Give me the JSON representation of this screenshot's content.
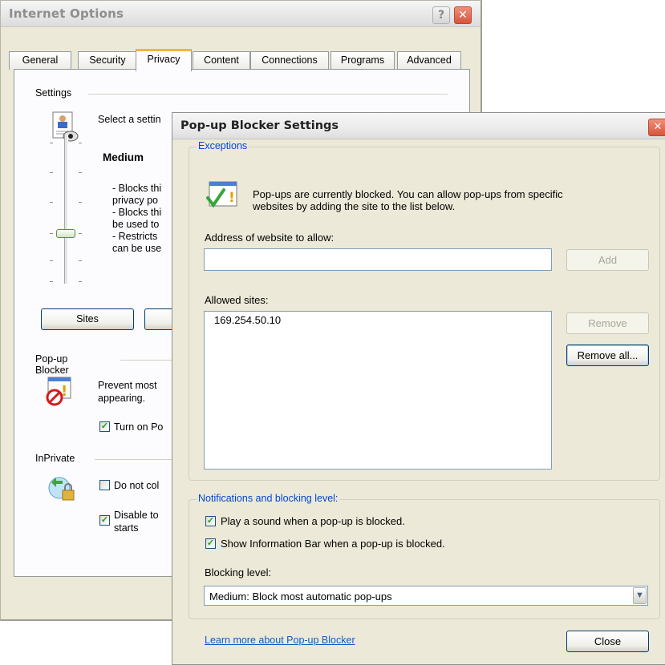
{
  "internet_options": {
    "title": "Internet Options",
    "help_glyph": "?",
    "close_glyph": "✕",
    "tabs": [
      {
        "label": "General"
      },
      {
        "label": "Security"
      },
      {
        "label": "Privacy"
      },
      {
        "label": "Content"
      },
      {
        "label": "Connections"
      },
      {
        "label": "Programs"
      },
      {
        "label": "Advanced"
      }
    ],
    "active_tab": "Privacy",
    "settings_group": "Settings",
    "select_setting_text": "Select a settin",
    "privacy_level": "Medium",
    "privacy_desc": [
      "- Blocks thi",
      "privacy po",
      "- Blocks thi",
      "be used to",
      "- Restricts",
      "can be use"
    ],
    "sites_button": "Sites",
    "popup_group": "Pop-up Blocker",
    "popup_desc_1": "Prevent most",
    "popup_desc_2": "appearing.",
    "turn_on_label": "Turn on Po",
    "turn_on_checked": true,
    "inprivate_group": "InPrivate",
    "do_not_collect_label": "Do not col",
    "do_not_collect_checked": false,
    "disable_label_1": "Disable to",
    "disable_label_2": "starts",
    "disable_checked": true
  },
  "popup_settings": {
    "title": "Pop-up Blocker Settings",
    "close_glyph": "✕",
    "exceptions_legend": "Exceptions",
    "info_line_1": "Pop-ups are currently blocked.  You can allow pop-ups from specific",
    "info_line_2": "websites by adding the site to the list below.",
    "address_label": "Address of website to allow:",
    "address_value": "",
    "add_button": "Add",
    "allowed_label": "Allowed sites:",
    "allowed_sites": [
      "169.254.50.10"
    ],
    "remove_button": "Remove",
    "remove_all_button": "Remove all...",
    "notifications_legend": "Notifications and blocking level:",
    "play_sound_label": "Play a sound when a pop-up is blocked.",
    "play_sound_checked": true,
    "info_bar_label": "Show Information Bar when a pop-up is blocked.",
    "info_bar_checked": true,
    "blocking_label": "Blocking level:",
    "blocking_value": "Medium: Block most automatic pop-ups",
    "learn_more_link": "Learn more about Pop-up Blocker",
    "close_button": "Close"
  },
  "check_glyph": "✓",
  "colors": {
    "accent_tab": "#f1b53e",
    "legend_blue": "#0046d5",
    "link_blue": "#0e5bc4",
    "close_red": "#d9533a"
  }
}
